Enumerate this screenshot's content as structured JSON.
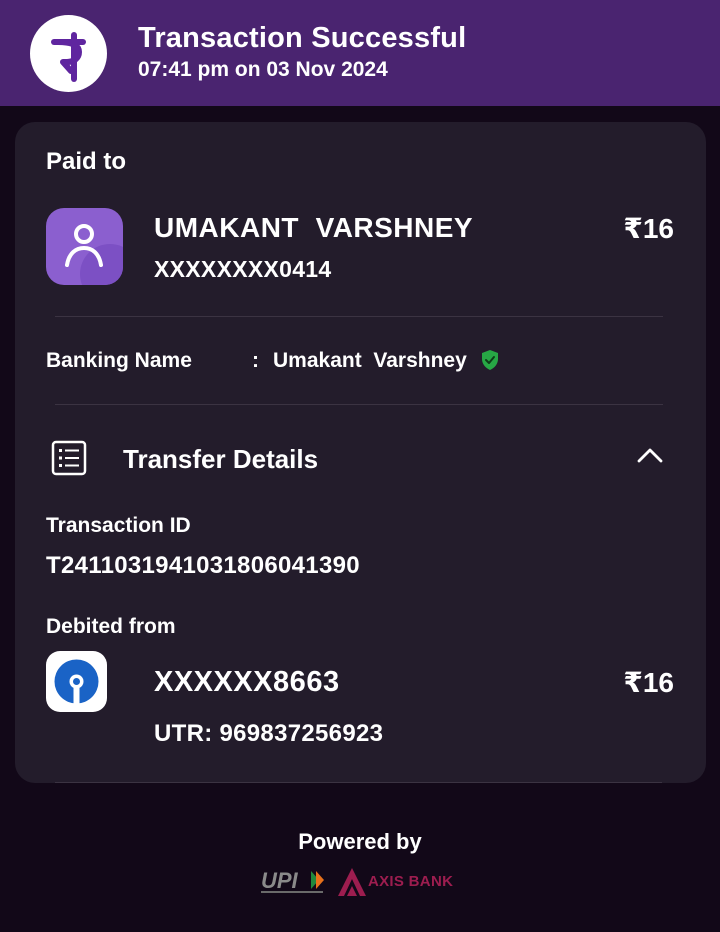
{
  "header": {
    "title": "Transaction Successful",
    "datetime": "07:41 pm on 03 Nov 2024",
    "logo_icon": "phonepe-logo-icon",
    "background": "#4a2470"
  },
  "payee": {
    "section_label": "Paid to",
    "name": "UMAKANT  VARSHNEY",
    "account": "XXXXXXXX0414",
    "amount": "₹16",
    "avatar_icon": "user-avatar-icon"
  },
  "banking": {
    "label": "Banking Name",
    "separator": ":",
    "value": "Umakant  Varshney",
    "verified_icon": "verified-shield-icon"
  },
  "transfer": {
    "label": "Transfer Details",
    "icon": "list-details-icon",
    "toggle_icon": "chevron-up-icon",
    "transaction_id_label": "Transaction ID",
    "transaction_id": "T2411031941031806041390",
    "debited_from_label": "Debited from",
    "debited_account": "XXXXXX8663",
    "debited_amount": "₹16",
    "utr": "UTR: 969837256923",
    "bank_icon": "sbi-bank-logo-icon"
  },
  "footer": {
    "powered_by": "Powered by",
    "upi_logo_text": "UPI",
    "bank_name": "AXIS BANK"
  },
  "colors": {
    "page_background": "#120818",
    "card_background": "#231c2b",
    "verified_green": "#27a745",
    "axis_maroon": "#9d1d4f",
    "sbi_blue": "#1a63c6"
  }
}
